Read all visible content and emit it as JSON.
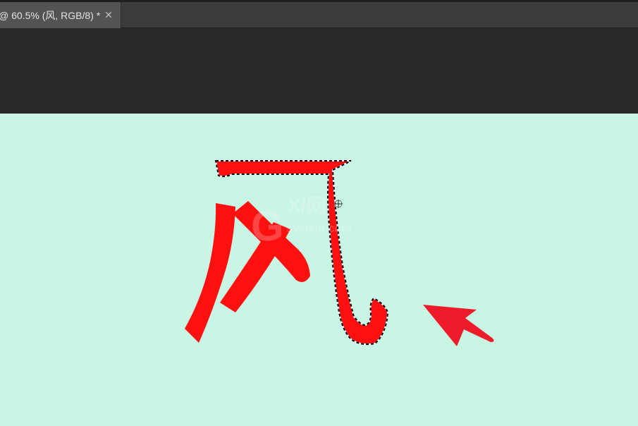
{
  "document_tab": {
    "title": "@ 60.5% (风, RGB/8) *",
    "close_icon": "close-icon"
  },
  "canvas": {
    "background_color": "#c8f5e4",
    "glyph": "风",
    "glyph_color": "#ff1010",
    "arrow_color": "#ee1c2a",
    "selection": "marching-ants-outline",
    "cursor": "crosshair-icon",
    "watermark": {
      "logo": "GX/网",
      "domain": "system.com"
    }
  }
}
